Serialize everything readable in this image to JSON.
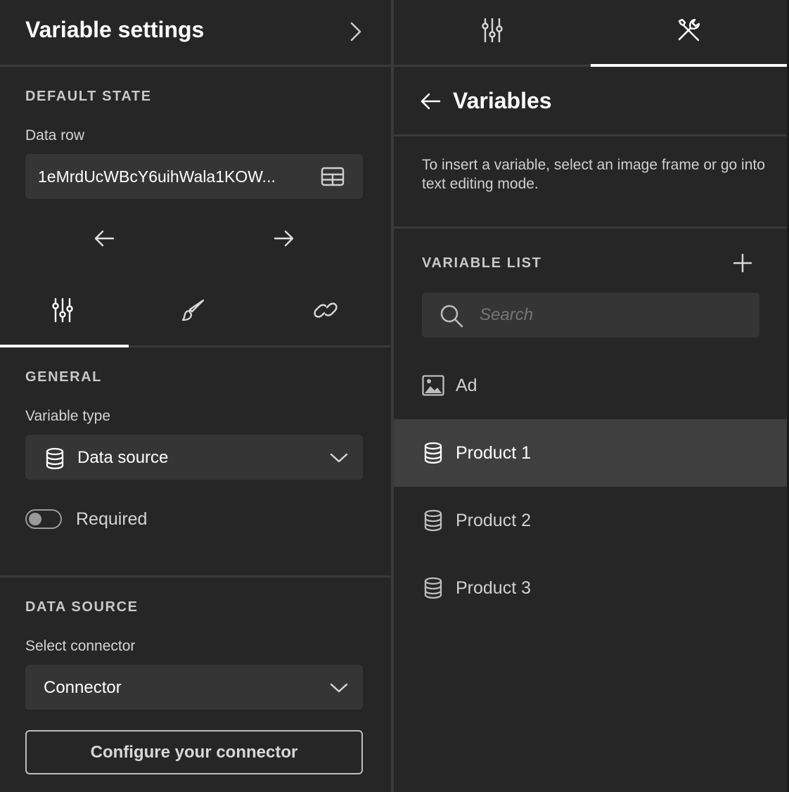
{
  "left": {
    "title": "Variable settings",
    "default_state": {
      "section": "DEFAULT STATE",
      "data_row_label": "Data row",
      "data_row_value": "1eMrdUcWBcY6uihWala1KOW..."
    },
    "tabs": [
      "properties-icon",
      "style-icon",
      "link-icon"
    ],
    "general": {
      "section": "GENERAL",
      "variable_type_label": "Variable type",
      "variable_type_value": "Data source",
      "required_label": "Required",
      "required_on": false
    },
    "data_source": {
      "section": "DATA SOURCE",
      "connector_label": "Select connector",
      "connector_value": "Connector",
      "configure_button": "Configure your connector"
    }
  },
  "right": {
    "tabs": [
      "sliders-icon",
      "tools-icon"
    ],
    "active_tab": "tools-icon",
    "title": "Variables",
    "hint": "To insert a variable, select an image frame or go into text editing mode.",
    "list_section": "VARIABLE LIST",
    "search_placeholder": "Search",
    "variables": [
      {
        "name": "Ad",
        "icon": "image-icon"
      },
      {
        "name": "Product 1",
        "icon": "database-icon",
        "selected": true
      },
      {
        "name": "Product 2",
        "icon": "database-icon"
      },
      {
        "name": "Product 3",
        "icon": "database-icon"
      }
    ]
  },
  "colors": {
    "panel": "#262626",
    "input": "#353535",
    "selected_row": "#3f3f3f",
    "accent": "#ffffff"
  }
}
